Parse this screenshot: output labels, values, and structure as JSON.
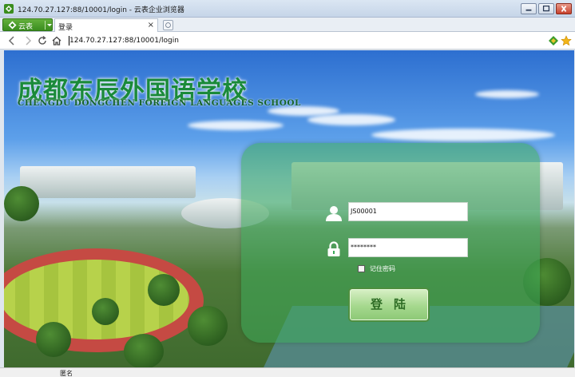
{
  "window": {
    "title": "124.70.27.127:88/10001/login - 云表企业浏览器"
  },
  "tabbar": {
    "brand_label": "云表",
    "tab_label": "登录",
    "tab_close": "×"
  },
  "navbar": {
    "address": "124.70.27.127:88/10001/login"
  },
  "hero": {
    "school_name_cn": "成都东辰外国语学校",
    "school_name_en": "CHENGDU DONGCHEN FOREIGN LANGUAGES SCHOOL"
  },
  "login": {
    "username_value": "JS00001",
    "password_value": "********",
    "remember_label": "记住密码",
    "remember_checked": false,
    "submit_label": "登陆"
  },
  "statusbar": {
    "text": "匿名"
  },
  "colors": {
    "brand_green": "#3a8d1e",
    "school_title_green": "#1a8a3a",
    "panel_green": "#3caa5a"
  },
  "icons": [
    "app-logo-icon",
    "minimize-icon",
    "maximize-icon",
    "close-icon",
    "back-icon",
    "forward-icon",
    "reload-icon",
    "home-icon",
    "extension-icon",
    "star-icon",
    "user-icon",
    "lock-icon"
  ]
}
